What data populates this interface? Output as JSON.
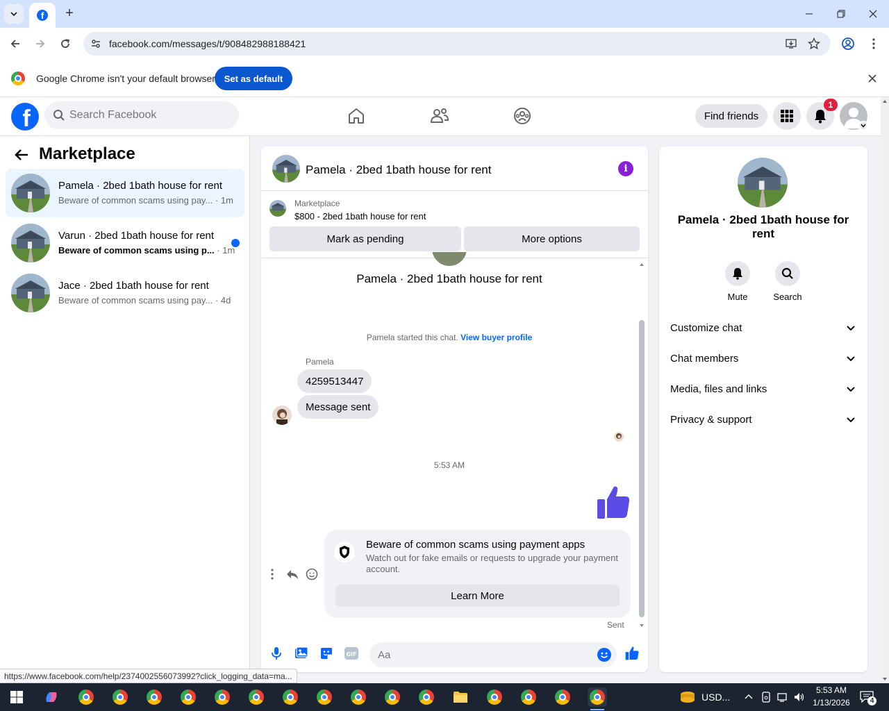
{
  "browser": {
    "url": "facebook.com/messages/t/908482988188421",
    "infobar_text": "Google Chrome isn't your default browser",
    "set_default_label": "Set as default",
    "status_url": "https://www.facebook.com/help/2374002556073992?click_logging_data=ma..."
  },
  "header": {
    "search_placeholder": "Search Facebook",
    "find_friends_label": "Find friends",
    "notification_count": "1"
  },
  "sidebar": {
    "title": "Marketplace",
    "conversations": [
      {
        "name": "Pamela · 2bed 1bath house for rent",
        "preview": "Beware of common scams using pay...",
        "time": "· 1m",
        "active": true,
        "unread": false
      },
      {
        "name": "Varun · 2bed 1bath house for rent",
        "preview": "Beware of common scams using p...",
        "time": "· 1m",
        "active": false,
        "unread": true
      },
      {
        "name": "Jace · 2bed 1bath house for rent",
        "preview": "Beware of common scams using pay...",
        "time": "· 4d",
        "active": false,
        "unread": false
      }
    ]
  },
  "chat": {
    "title": "Pamela · 2bed 1bath house for rent",
    "listing_label": "Marketplace",
    "listing_price_title": "$800 - 2bed 1bath house for rent",
    "mark_pending_label": "Mark as pending",
    "more_options_label": "More options",
    "center_name": "Pamela · 2bed 1bath house for rent",
    "started_text": "Pamela started this chat.",
    "view_profile_label": "View buyer profile",
    "sender_name": "Pamela",
    "messages": [
      "4259513447",
      "Message sent"
    ],
    "timestamp": "5:53 AM",
    "scam_title": "Beware of common scams using payment apps",
    "scam_body": "Watch out for fake emails or requests to upgrade your payment account.",
    "learn_more_label": "Learn More",
    "sent_label": "Sent",
    "composer_placeholder": "Aa"
  },
  "info_panel": {
    "name": "Pamela · 2bed 1bath house for rent",
    "mute_label": "Mute",
    "search_label": "Search",
    "sections": [
      "Customize chat",
      "Chat members",
      "Media, files and links",
      "Privacy & support"
    ]
  },
  "taskbar": {
    "currency_label": "USD...",
    "time": "5:53 AM",
    "date": "1/13/2026",
    "notification_count": "4"
  },
  "colors": {
    "fb_blue": "#0866ff",
    "chat_accent": "#5b4ce8",
    "info_purple": "#8a1fd6"
  }
}
